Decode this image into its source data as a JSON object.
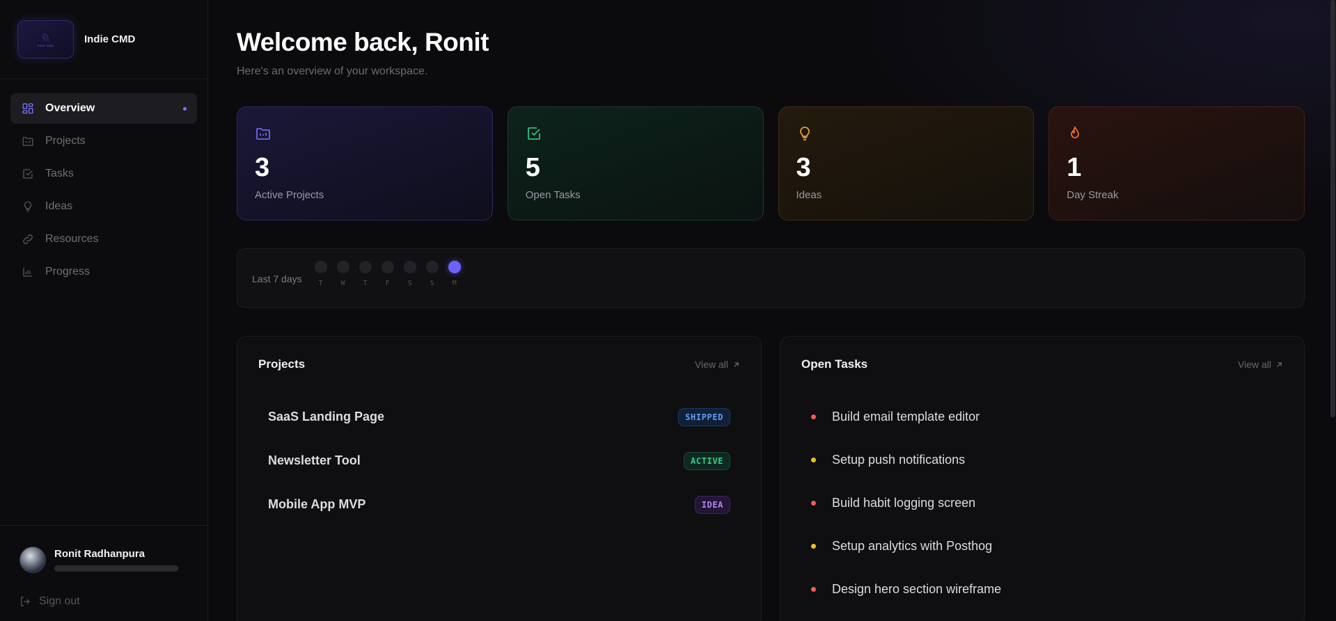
{
  "colors": {
    "accent": "#6c63ff",
    "purple": "#6f66e6",
    "green": "#2fbf85",
    "orange": "#e2a23b",
    "red": "#ef6a2e",
    "priority_high": "#f25c5c",
    "priority_medium": "#f2c21b"
  },
  "brand": {
    "name": "Indie CMD",
    "logo_mark": "♘",
    "logo_text": "Indie CMD"
  },
  "nav": {
    "items": [
      {
        "label": "Overview",
        "icon": "grid-icon",
        "active": true
      },
      {
        "label": "Projects",
        "icon": "folder-icon",
        "active": false
      },
      {
        "label": "Tasks",
        "icon": "checkbox-icon",
        "active": false
      },
      {
        "label": "Ideas",
        "icon": "lightbulb-icon",
        "active": false
      },
      {
        "label": "Resources",
        "icon": "link-icon",
        "active": false
      },
      {
        "label": "Progress",
        "icon": "bar-chart-icon",
        "active": false
      }
    ]
  },
  "user": {
    "name": "Ronit Radhanpura",
    "sign_out": "Sign out"
  },
  "header": {
    "title": "Welcome back, Ronit",
    "subtitle": "Here's an overview of your workspace."
  },
  "stats": [
    {
      "value": "3",
      "label": "Active Projects",
      "icon": "folder-icon"
    },
    {
      "value": "5",
      "label": "Open Tasks",
      "icon": "checkbox-icon"
    },
    {
      "value": "3",
      "label": "Ideas",
      "icon": "lightbulb-icon"
    },
    {
      "value": "1",
      "label": "Day Streak",
      "icon": "flame-icon"
    }
  ],
  "activity": {
    "label": "Last 7 days",
    "days": [
      {
        "letter": "T",
        "active": false
      },
      {
        "letter": "W",
        "active": false
      },
      {
        "letter": "T",
        "active": false
      },
      {
        "letter": "F",
        "active": false
      },
      {
        "letter": "S",
        "active": false
      },
      {
        "letter": "S",
        "active": false
      },
      {
        "letter": "M",
        "active": true
      }
    ]
  },
  "projects_panel": {
    "title": "Projects",
    "view_all": "View all",
    "items": [
      {
        "name": "SaaS Landing Page",
        "status": "SHIPPED"
      },
      {
        "name": "Newsletter Tool",
        "status": "ACTIVE"
      },
      {
        "name": "Mobile App MVP",
        "status": "IDEA"
      }
    ]
  },
  "tasks_panel": {
    "title": "Open Tasks",
    "view_all": "View all",
    "items": [
      {
        "text": "Build email template editor",
        "priority": "high"
      },
      {
        "text": "Setup push notifications",
        "priority": "medium"
      },
      {
        "text": "Build habit logging screen",
        "priority": "high"
      },
      {
        "text": "Setup analytics with Posthog",
        "priority": "medium"
      },
      {
        "text": "Design hero section wireframe",
        "priority": "high"
      }
    ]
  }
}
